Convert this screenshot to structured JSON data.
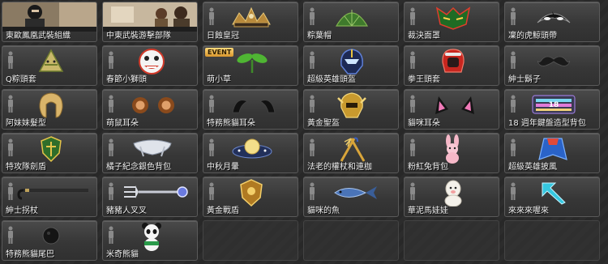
{
  "items": [
    {
      "label": "東歐鳳凰武裝組織",
      "icon": "soldier-portrait-icon"
    },
    {
      "label": "中東武裝游擊部隊",
      "icon": "soldiers-portrait-icon"
    },
    {
      "label": "日蝕皇冠",
      "icon": "crown-icon"
    },
    {
      "label": "粽葉帽",
      "icon": "leaf-hat-icon"
    },
    {
      "label": "裁決面罩",
      "icon": "mask-icon"
    },
    {
      "label": "凜的虎鯨頭帶",
      "icon": "orca-headband-icon"
    },
    {
      "label": "Q粽頭套",
      "icon": "rice-dumpling-icon"
    },
    {
      "label": "春節小獅頭",
      "icon": "lion-head-icon"
    },
    {
      "label": "萌小草",
      "icon": "sprout-icon",
      "badge": "EVENT"
    },
    {
      "label": "超級英雄頭盔",
      "icon": "hero-helmet-icon"
    },
    {
      "label": "拳王頭套",
      "icon": "boxing-headgear-icon"
    },
    {
      "label": "紳士鬍子",
      "icon": "mustache-icon"
    },
    {
      "label": "阿妹妹髮型",
      "icon": "hairstyle-icon"
    },
    {
      "label": "萌鼠耳朵",
      "icon": "mouse-ears-icon"
    },
    {
      "label": "特務熊貓耳朵",
      "icon": "panda-ears-icon"
    },
    {
      "label": "黃金聖盔",
      "icon": "gold-helmet-icon"
    },
    {
      "label": "貓咪耳朵",
      "icon": "cat-ears-icon"
    },
    {
      "label": "18 週年鍵盤造型背包",
      "icon": "keyboard-backpack-icon"
    },
    {
      "label": "特攻隊劍盾",
      "icon": "shield-icon"
    },
    {
      "label": "橘子紀念銀色背包",
      "icon": "silver-backpack-icon"
    },
    {
      "label": "中秋月暈",
      "icon": "moon-halo-icon"
    },
    {
      "label": "法老的權杖和連枷",
      "icon": "scepter-flail-icon"
    },
    {
      "label": "粉紅兔背包",
      "icon": "pink-rabbit-icon"
    },
    {
      "label": "超級英雄披風",
      "icon": "hero-cape-icon"
    },
    {
      "label": "紳士拐杖",
      "icon": "cane-icon"
    },
    {
      "label": "豬豬人叉叉",
      "icon": "fork-icon"
    },
    {
      "label": "黃金戰盾",
      "icon": "gold-shield-icon"
    },
    {
      "label": "貓咪的魚",
      "icon": "fish-icon"
    },
    {
      "label": "華泥馬娃娃",
      "icon": "alpaca-doll-icon"
    },
    {
      "label": "來來來喔來",
      "icon": "arrow-icon"
    },
    {
      "label": "特務熊貓尾巴",
      "icon": "panda-tail-icon"
    },
    {
      "label": "米奇熊貓",
      "icon": "panda-icon"
    }
  ]
}
